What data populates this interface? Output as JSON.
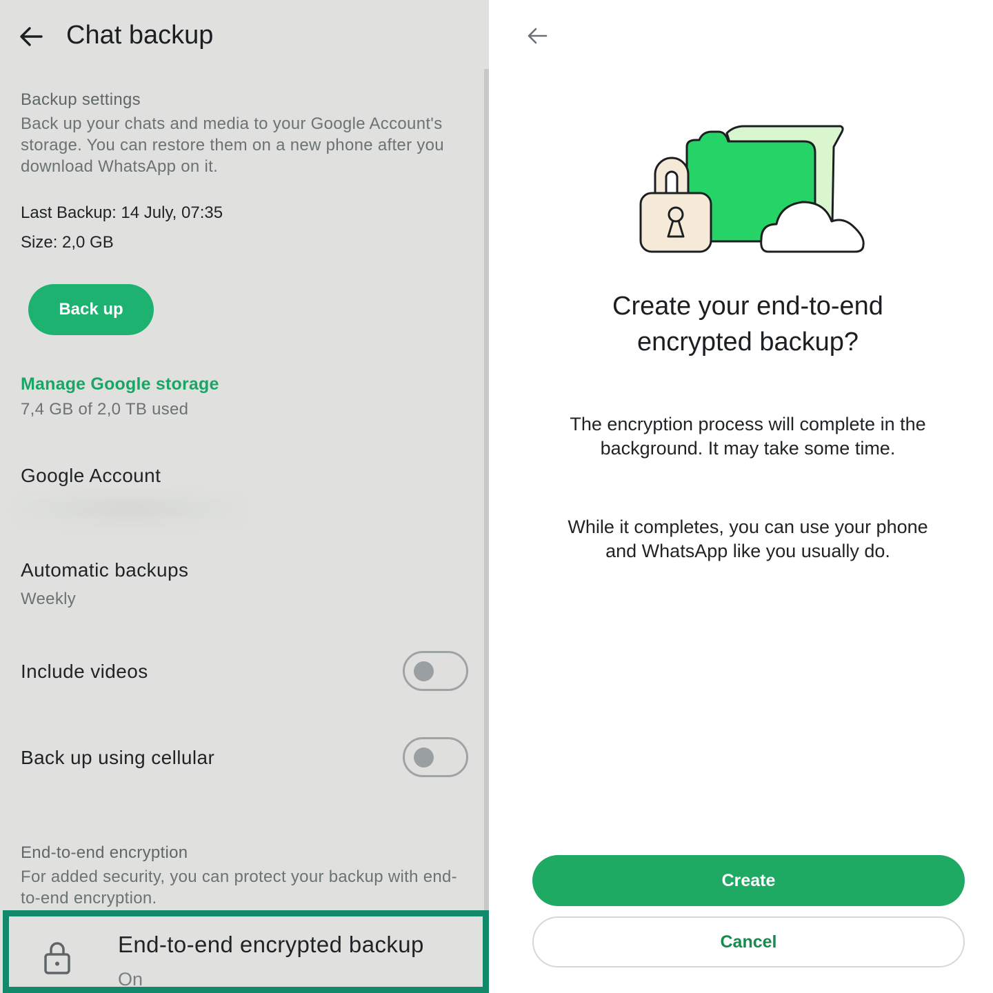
{
  "left": {
    "title": "Chat backup",
    "backup_settings_heading": "Backup settings",
    "backup_settings_desc": "Back up your chats and media to your Google Account's storage. You can restore them on a new phone after you download WhatsApp on it.",
    "last_backup": "Last Backup: 14 July, 07:35",
    "size": "Size: 2,0 GB",
    "backup_button": "Back up",
    "manage_storage": "Manage Google storage",
    "storage_used": "7,4 GB of 2,0 TB used",
    "google_account_label": "Google Account",
    "automatic_backups_label": "Automatic backups",
    "automatic_backups_value": "Weekly",
    "include_videos_label": "Include videos",
    "include_videos_on": false,
    "cellular_label": "Back up using cellular",
    "cellular_on": false,
    "e2e_heading": "End-to-end encryption",
    "e2e_desc": "For added security, you can protect your backup with end-to-end encryption.",
    "e2e_item_title": "End-to-end encrypted backup",
    "e2e_item_status": "On"
  },
  "right": {
    "headline_line1": "Create your end-to-end",
    "headline_line2": "encrypted backup?",
    "para1_line1": "The encryption process will complete in the",
    "para1_line2": "background. It may take some time.",
    "para2_line1": "While it completes, you can use your phone",
    "para2_line2": "and WhatsApp like you usually do.",
    "create_button": "Create",
    "cancel_button": "Cancel"
  },
  "colors": {
    "accent_green": "#1eb271",
    "highlight_border": "#12896a",
    "link_green": "#1aa566",
    "left_background": "#e0e1de"
  },
  "icons": [
    "back-arrow-icon",
    "lock-icon",
    "backup-illustration"
  ]
}
